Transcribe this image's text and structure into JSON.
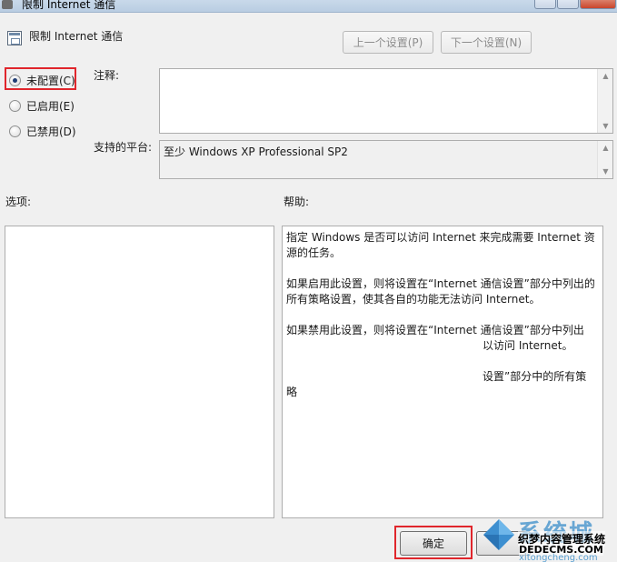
{
  "window": {
    "title": "限制 Internet 通信"
  },
  "header": {
    "policy_name": "限制 Internet 通信",
    "prev_button": "上一个设置(P)",
    "next_button": "下一个设置(N)"
  },
  "options": {
    "not_configured": "未配置(C)",
    "enabled": "已启用(E)",
    "disabled": "已禁用(D)",
    "selected": "not_configured"
  },
  "comment": {
    "label": "注释:",
    "value": ""
  },
  "platform": {
    "label": "支持的平台:",
    "value": "至少 Windows XP Professional SP2"
  },
  "sections": {
    "options_label": "选项:",
    "help_label": "帮助:"
  },
  "help": {
    "text": "指定 Windows 是否可以访问 Internet 来完成需要 Internet 资源的任务。\n\n如果启用此设置，则将设置在“Internet 通信设置”部分中列出的所有策略设置，使其各自的功能无法访问 Internet。\n\n如果禁用此设置，则将设置在“Internet 通信设置”部分中列出\n　　　　　　　　　　　　　　　　　　以访问 Internet。\n\n　　　　　　　　　　　　　　　　　　设置”部分中的所有策略"
  },
  "footer": {
    "ok_button": "确定"
  },
  "watermark": {
    "big_text": "系统城",
    "line1": "织梦内容管理系统",
    "line2": "DEDECMS.COM",
    "line3": "xitongcheng.com"
  },
  "colors": {
    "highlight_box": "#e0262c",
    "window_bg": "#f0f0f0"
  }
}
